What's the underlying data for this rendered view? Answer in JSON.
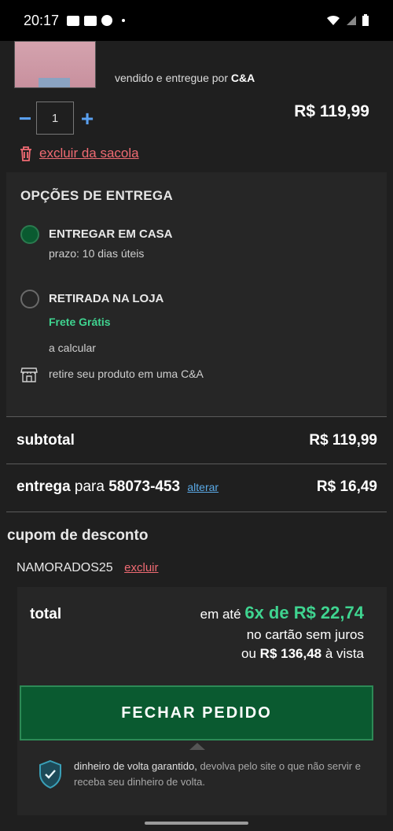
{
  "status_bar": {
    "time": "20:17"
  },
  "product": {
    "sold_by_prefix": "vendido e entregue por",
    "seller": "C&A",
    "quantity": "1",
    "price": "R$ 119,99",
    "remove_label": "excluir da sacola"
  },
  "delivery": {
    "title": "OPÇÕES DE ENTREGA",
    "home": {
      "title": "ENTREGAR EM CASA",
      "deadline": "prazo: 10 dias úteis",
      "selected": true
    },
    "pickup": {
      "title": "RETIRADA NA LOJA",
      "free_label": "Frete Grátis",
      "calc_label": "a calcular",
      "store_note": "retire seu produto em uma C&A",
      "selected": false
    }
  },
  "summary": {
    "subtotal_label": "subtotal",
    "subtotal_value": "R$ 119,99",
    "shipping_label": "entrega",
    "shipping_for": "para",
    "zipcode": "58073-453",
    "change_label": "alterar",
    "shipping_value": "R$ 16,49"
  },
  "coupon": {
    "title": "cupom de desconto",
    "code": "NAMORADOS25",
    "remove_label": "excluir"
  },
  "total": {
    "label": "total",
    "installments_prefix": "em até",
    "installments": "6x de R$ 22,74",
    "no_interest": "no cartão sem juros",
    "cash_prefix": "ou",
    "cash_value": "R$ 136,48",
    "cash_suffix": "à vista"
  },
  "checkout_button": "FECHAR PEDIDO",
  "guarantee": {
    "strong": "dinheiro de volta garantido,",
    "text": " devolva pelo site o que não servir e receba seu dinheiro de volta."
  },
  "colors": {
    "accent_green": "#3fd490",
    "button_green": "#0a5a30",
    "link_red": "#f06b73",
    "link_blue": "#5aa9e6"
  }
}
